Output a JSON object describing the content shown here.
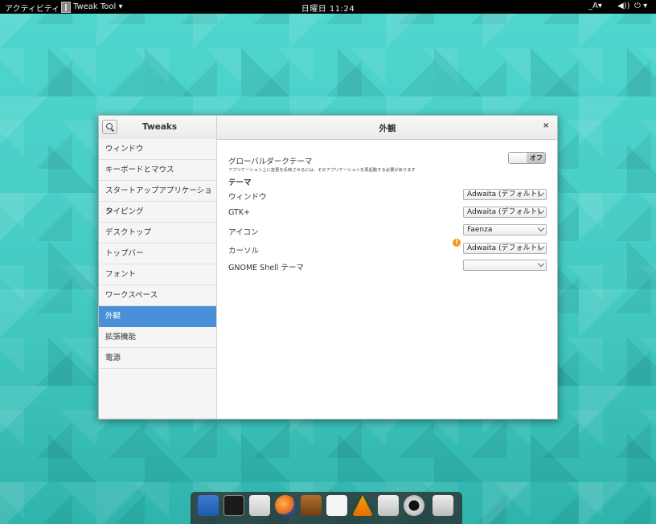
{
  "topbar": {
    "activities": "アクティビティ",
    "app_menu": "Tweak Tool ▾",
    "clock": "日曜日 11:24",
    "input_method": "_A▾",
    "volume_icon": "speaker-icon",
    "power_icon": "power-icon"
  },
  "window": {
    "left_title": "Tweaks",
    "right_title": "外観",
    "close_label": "×",
    "sidebar_items": [
      {
        "label": "ウィンドウ"
      },
      {
        "label": "キーボードとマウス"
      },
      {
        "label": "スタートアップアプリケーション"
      },
      {
        "label": "タイピング"
      },
      {
        "label": "デスクトップ"
      },
      {
        "label": "トップバー"
      },
      {
        "label": "フォント"
      },
      {
        "label": "ワークスペース"
      },
      {
        "label": "外観",
        "selected": true
      },
      {
        "label": "拡張機能"
      },
      {
        "label": "電源"
      }
    ],
    "content": {
      "global_dark_theme": {
        "label": "グローバルダークテーマ",
        "sublabel": "アプリケーション上に変更を反映させるには、そのアプリケーションを再起動する必要があります",
        "state_label": "オフ",
        "enabled": false
      },
      "theme_heading": "テーマ",
      "rows": [
        {
          "label": "ウィンドウ",
          "value": "Adwaita (デフォルト)"
        },
        {
          "label": "GTK+",
          "value": "Adwaita (デフォルト)"
        },
        {
          "label": "アイコン",
          "value": "Faenza"
        },
        {
          "label": "カーソル",
          "value": "Adwaita (デフォルト)"
        },
        {
          "label": "GNOME Shell テーマ",
          "value": ""
        }
      ]
    }
  },
  "dock": {
    "apps": [
      "anchor-icon",
      "terminal-icon",
      "file-cabinet-icon",
      "firefox-icon",
      "speaker-app-icon",
      "chat-icon",
      "vlc-icon",
      "mixer-icon",
      "camera-icon",
      "trash-icon"
    ]
  },
  "colors": {
    "selection": "#4a90d9",
    "desktop": "#45cbc4",
    "warning": "#f39a1e"
  }
}
